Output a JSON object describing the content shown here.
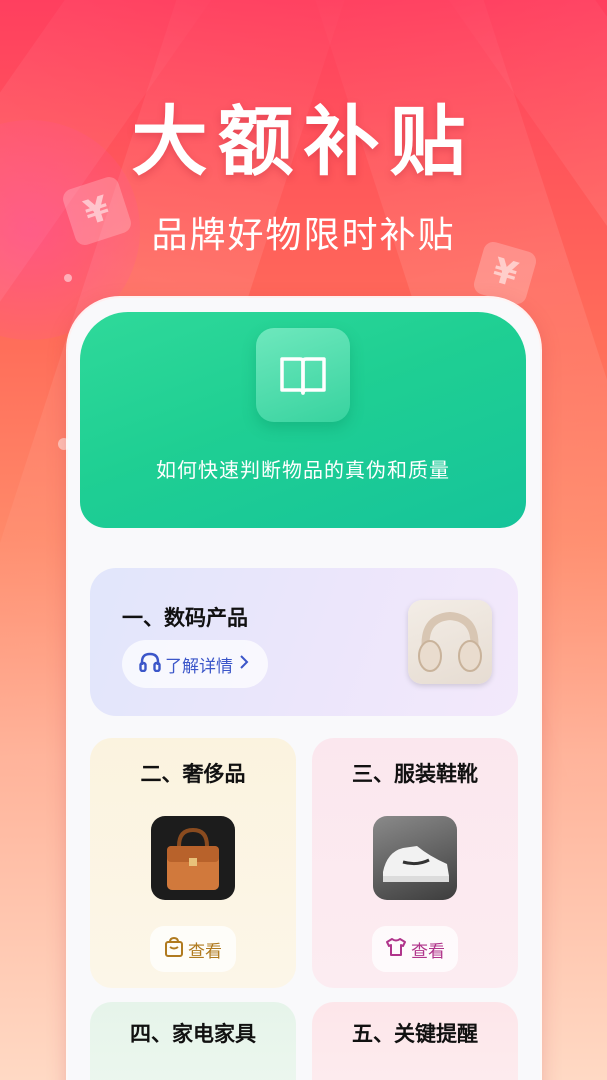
{
  "banner": {
    "title": "大额补贴",
    "subtitle": "品牌好物限时补贴"
  },
  "hero_card": {
    "icon": "book-icon",
    "caption": "如何快速判断物品的真伪和质量"
  },
  "categories": [
    {
      "title": "一、数码产品",
      "button_label": "了解详情",
      "button_icon": "headphones-icon"
    },
    {
      "title": "二、奢侈品",
      "button_label": "查看",
      "button_icon": "bag-icon"
    },
    {
      "title": "三、服装鞋靴",
      "button_label": "查看",
      "button_icon": "shirt-icon"
    },
    {
      "title": "四、家电家具"
    },
    {
      "title": "五、关键提醒"
    }
  ],
  "colors": {
    "background_top": "#ff3f5f",
    "hero_green": "#1fcf93",
    "digital_blue": "#3b56c9",
    "luxury_gold": "#b07a1f",
    "clothing_magenta": "#b0348b"
  }
}
